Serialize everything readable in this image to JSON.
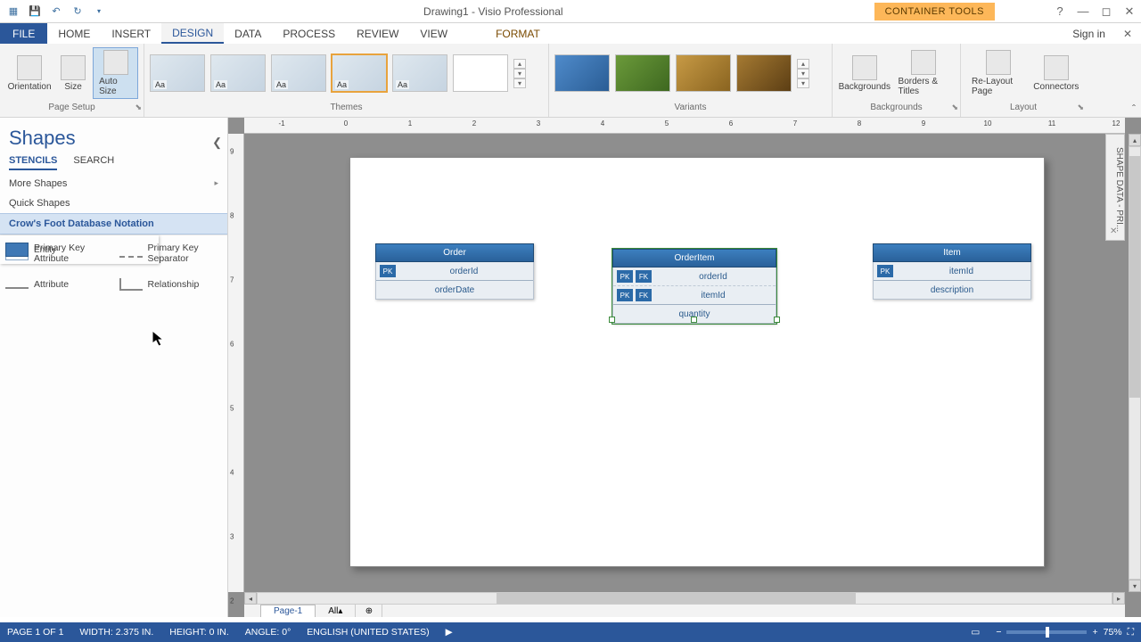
{
  "title": "Drawing1 - Visio Professional",
  "context_tool": "CONTAINER TOOLS",
  "tabs": {
    "file": "FILE",
    "home": "HOME",
    "insert": "INSERT",
    "design": "DESIGN",
    "data": "DATA",
    "process": "PROCESS",
    "review": "REVIEW",
    "view": "VIEW",
    "format": "FORMAT",
    "signin": "Sign in"
  },
  "ribbon": {
    "page_setup": {
      "label": "Page Setup",
      "orientation": "Orientation",
      "size": "Size",
      "autosize": "Auto Size"
    },
    "themes": {
      "label": "Themes"
    },
    "variants": {
      "label": "Variants"
    },
    "backgrounds": {
      "label": "Backgrounds",
      "backgrounds": "Backgrounds",
      "borders": "Borders & Titles"
    },
    "layout": {
      "label": "Layout",
      "relayout": "Re-Layout Page",
      "connectors": "Connectors"
    }
  },
  "shapes_panel": {
    "title": "Shapes",
    "tab_stencils": "STENCILS",
    "tab_search": "SEARCH",
    "more": "More Shapes",
    "quick": "Quick Shapes",
    "stencil": "Crow's Foot Database Notation",
    "items": {
      "entity": "Entity",
      "pk_attr": "Primary Key Attribute",
      "pk_sep": "Primary Key Separator",
      "attribute": "Attribute",
      "relationship": "Relationship"
    }
  },
  "entities": {
    "order": {
      "name": "Order",
      "rows": [
        {
          "keys": [
            "PK"
          ],
          "name": "orderId",
          "sep": true
        },
        {
          "keys": [],
          "name": "orderDate"
        }
      ]
    },
    "orderitem": {
      "name": "OrderItem",
      "rows": [
        {
          "keys": [
            "PK",
            "FK"
          ],
          "name": "orderId"
        },
        {
          "keys": [
            "PK",
            "FK"
          ],
          "name": "itemId",
          "sep": true
        },
        {
          "keys": [],
          "name": "quantity"
        }
      ]
    },
    "item": {
      "name": "Item",
      "rows": [
        {
          "keys": [
            "PK"
          ],
          "name": "itemId",
          "sep": true
        },
        {
          "keys": [],
          "name": "description"
        }
      ]
    }
  },
  "shapedata_label": "SHAPE DATA - PRI...",
  "pagetabs": {
    "page1": "Page-1",
    "all": "All"
  },
  "status": {
    "page": "PAGE 1 OF 1",
    "width": "WIDTH: 2.375 IN.",
    "height": "HEIGHT: 0 IN.",
    "angle": "ANGLE: 0°",
    "lang": "ENGLISH (UNITED STATES)",
    "zoom": "75%"
  },
  "ruler_h": [
    "-1",
    "0",
    "1",
    "2",
    "3",
    "4",
    "5",
    "6",
    "7",
    "8",
    "9",
    "10",
    "11",
    "12"
  ],
  "ruler_v": [
    "9",
    "8",
    "7",
    "6",
    "5",
    "4",
    "3",
    "2"
  ]
}
